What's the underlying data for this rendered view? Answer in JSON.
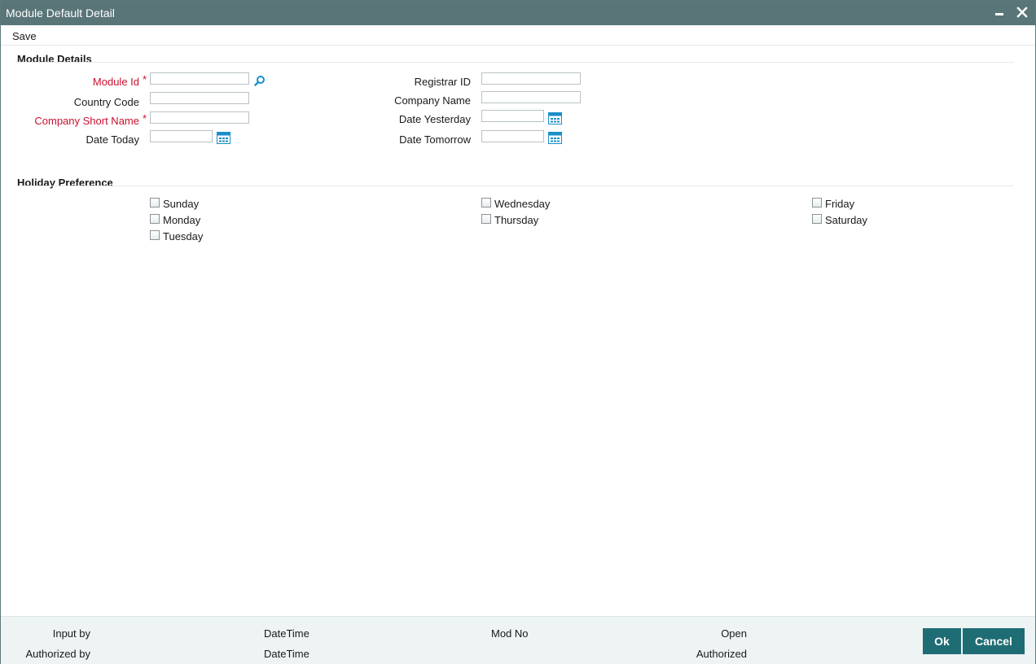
{
  "window": {
    "title": "Module Default Detail",
    "minimize_icon": "minimize-icon",
    "close_icon": "close-icon"
  },
  "toolbar": {
    "save_label": "Save"
  },
  "colors": {
    "titlebar": "#597578",
    "required": "#c8102e",
    "button": "#1f6d74",
    "footer": "#eef3f3",
    "icon": "#1a8fc9"
  },
  "module_details": {
    "title": "Module Details",
    "left": {
      "module_id": {
        "label": "Module Id",
        "required": "*",
        "value": "",
        "icon": "search-icon"
      },
      "country_code": {
        "label": "Country Code",
        "value": ""
      },
      "company_short_name": {
        "label": "Company Short Name",
        "required": "*",
        "value": ""
      },
      "date_today": {
        "label": "Date Today",
        "value": "",
        "icon": "calendar-icon"
      }
    },
    "right": {
      "registrar_id": {
        "label": "Registrar ID",
        "value": ""
      },
      "company_name": {
        "label": "Company Name",
        "value": ""
      },
      "date_yesterday": {
        "label": "Date Yesterday",
        "value": "",
        "icon": "calendar-icon"
      },
      "date_tomorrow": {
        "label": "Date Tomorrow",
        "value": "",
        "icon": "calendar-icon"
      }
    }
  },
  "holiday_preference": {
    "title": "Holiday Preference",
    "days": [
      {
        "label": "Sunday",
        "checked": false
      },
      {
        "label": "Monday",
        "checked": false
      },
      {
        "label": "Tuesday",
        "checked": false
      },
      {
        "label": "Wednesday",
        "checked": false
      },
      {
        "label": "Thursday",
        "checked": false
      },
      {
        "label": "Friday",
        "checked": false
      },
      {
        "label": "Saturday",
        "checked": false
      }
    ]
  },
  "footer": {
    "input_by": "Input by",
    "authorized_by": "Authorized by",
    "datetime_1": "DateTime",
    "datetime_2": "DateTime",
    "mod_no": "Mod No",
    "open": "Open",
    "authorized": "Authorized",
    "ok_label": "Ok",
    "cancel_label": "Cancel"
  }
}
